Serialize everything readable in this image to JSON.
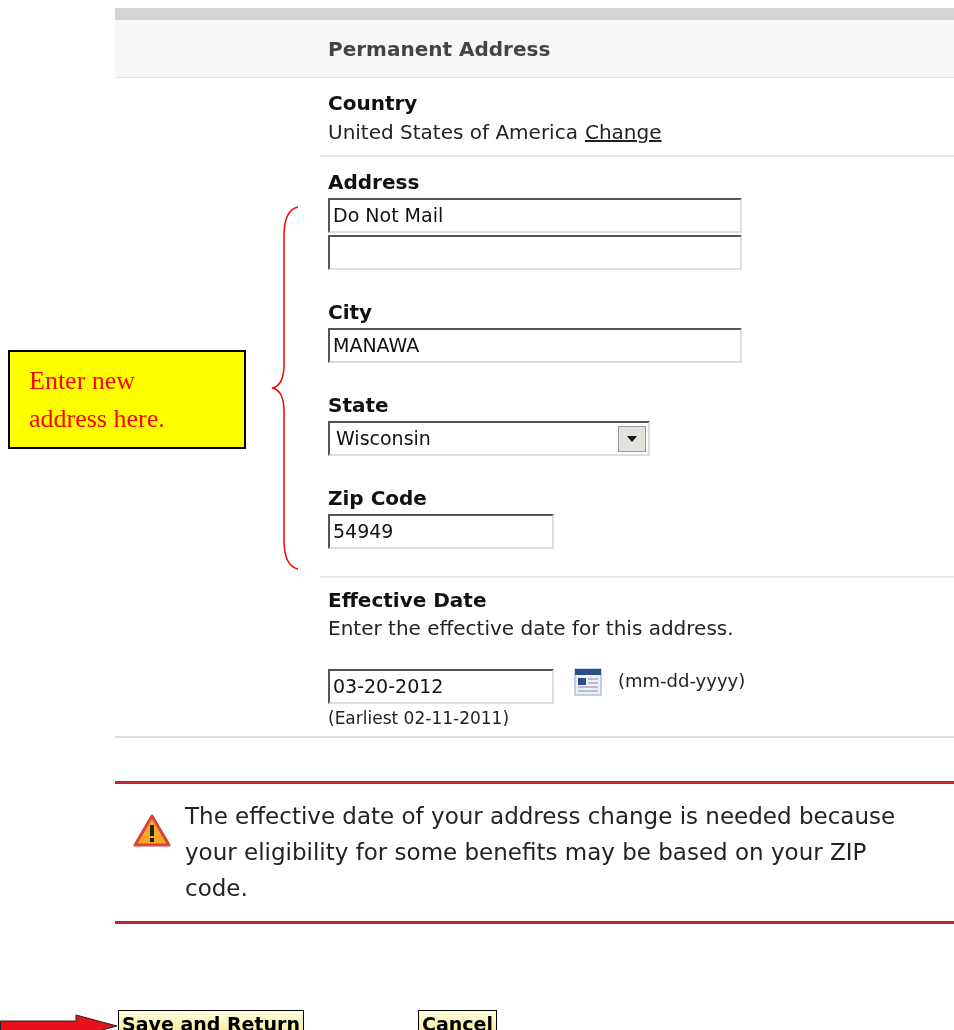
{
  "section_header": {
    "title": "Permanent Address"
  },
  "country": {
    "label": "Country",
    "value": "United States of America",
    "link": "Change"
  },
  "address": {
    "label": "Address",
    "line_1": "Do Not Mail"
  },
  "city": {
    "label": "City",
    "value": "MANAWA"
  },
  "state": {
    "label": "State",
    "value": "Wisconsin"
  },
  "zip": {
    "label": "Zip Code",
    "value": "54949"
  },
  "effective_date": {
    "label": "Effective Date",
    "instructions": "Enter the effective date for this address.",
    "value": "03-20-2012",
    "format": "(mm-dd-yyyy)",
    "earliest": "(Earliest 02-11-2011)"
  },
  "alert": {
    "message": "The effective date of your address change is needed because your eligibility for some benefits may be based on your ZIP code."
  },
  "buttons": [
    {
      "label": "Save and Return",
      "pointed": true
    },
    {
      "label": "Cancel",
      "pointed": false
    }
  ],
  "annotation": {
    "text": "Enter new address here."
  }
}
